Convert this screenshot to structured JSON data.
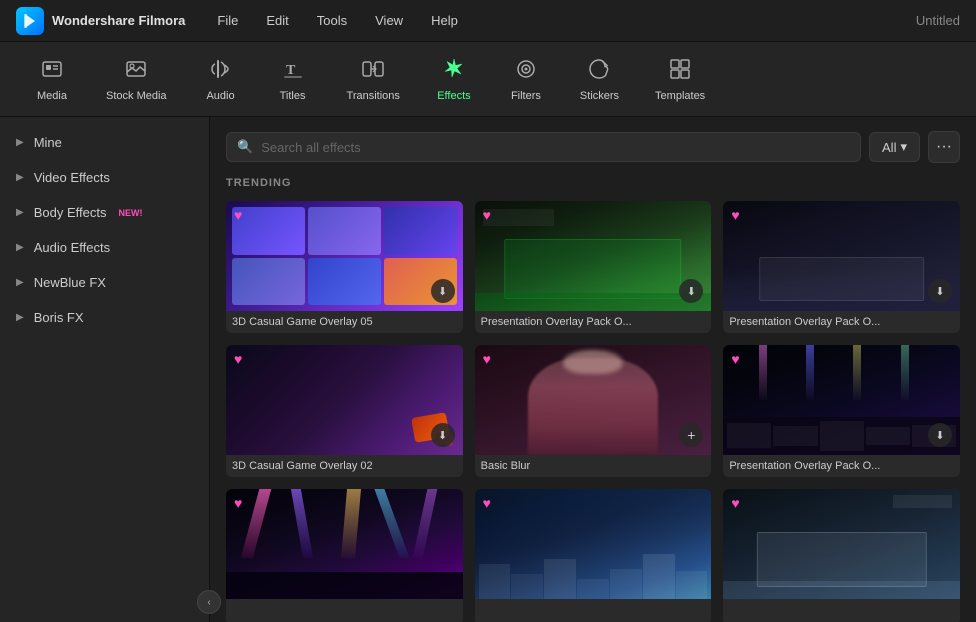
{
  "app": {
    "name": "Wondershare Filmora",
    "title": "Untitled"
  },
  "menu": {
    "items": [
      "File",
      "Edit",
      "Tools",
      "View",
      "Help"
    ]
  },
  "toolbar": {
    "items": [
      {
        "id": "media",
        "label": "Media",
        "icon": "⬛",
        "active": false
      },
      {
        "id": "stock-media",
        "label": "Stock Media",
        "icon": "🖼",
        "active": false
      },
      {
        "id": "audio",
        "label": "Audio",
        "icon": "♪",
        "active": false
      },
      {
        "id": "titles",
        "label": "Titles",
        "icon": "T",
        "active": false
      },
      {
        "id": "transitions",
        "label": "Transitions",
        "icon": "▶◀",
        "active": false
      },
      {
        "id": "effects",
        "label": "Effects",
        "icon": "✦",
        "active": true
      },
      {
        "id": "filters",
        "label": "Filters",
        "icon": "◎",
        "active": false
      },
      {
        "id": "stickers",
        "label": "Stickers",
        "icon": "🏷",
        "active": false
      },
      {
        "id": "templates",
        "label": "Templates",
        "icon": "⊞",
        "active": false
      }
    ]
  },
  "sidebar": {
    "items": [
      {
        "id": "mine",
        "label": "Mine"
      },
      {
        "id": "video-effects",
        "label": "Video Effects"
      },
      {
        "id": "body-effects",
        "label": "Body Effects",
        "badge": "NEW!"
      },
      {
        "id": "audio-effects",
        "label": "Audio Effects"
      },
      {
        "id": "newblue-fx",
        "label": "NewBlue FX"
      },
      {
        "id": "boris-fx",
        "label": "Boris FX"
      }
    ],
    "collapse_label": "‹"
  },
  "search": {
    "placeholder": "Search all effects",
    "filter_label": "All",
    "filter_dropdown": "▾",
    "more_icon": "···"
  },
  "content": {
    "section_title": "TRENDING",
    "cards": [
      {
        "id": "card-1",
        "label": "3D Casual Game Overlay 05",
        "thumb_type": "game-overlay-05",
        "has_heart": true,
        "has_download": true
      },
      {
        "id": "card-2",
        "label": "Presentation Overlay Pack O...",
        "thumb_type": "presentation-green",
        "has_heart": true,
        "has_download": true
      },
      {
        "id": "card-3",
        "label": "Presentation Overlay Pack O...",
        "thumb_type": "presentation-grey",
        "has_heart": true,
        "has_download": true
      },
      {
        "id": "card-4",
        "label": "3D Casual Game Overlay 02",
        "thumb_type": "game-overlay-02",
        "has_heart": true,
        "has_download": true
      },
      {
        "id": "card-5",
        "label": "Basic Blur",
        "thumb_type": "basic-blur",
        "has_heart": true,
        "has_add": true
      },
      {
        "id": "card-6",
        "label": "Presentation Overlay Pack O...",
        "thumb_type": "concert",
        "has_heart": true,
        "has_download": true
      },
      {
        "id": "card-7",
        "label": "",
        "thumb_type": "lights",
        "has_heart": true
      },
      {
        "id": "card-8",
        "label": "",
        "thumb_type": "stage",
        "has_heart": true
      },
      {
        "id": "card-9",
        "label": "",
        "thumb_type": "pres-white",
        "has_heart": true
      }
    ]
  }
}
